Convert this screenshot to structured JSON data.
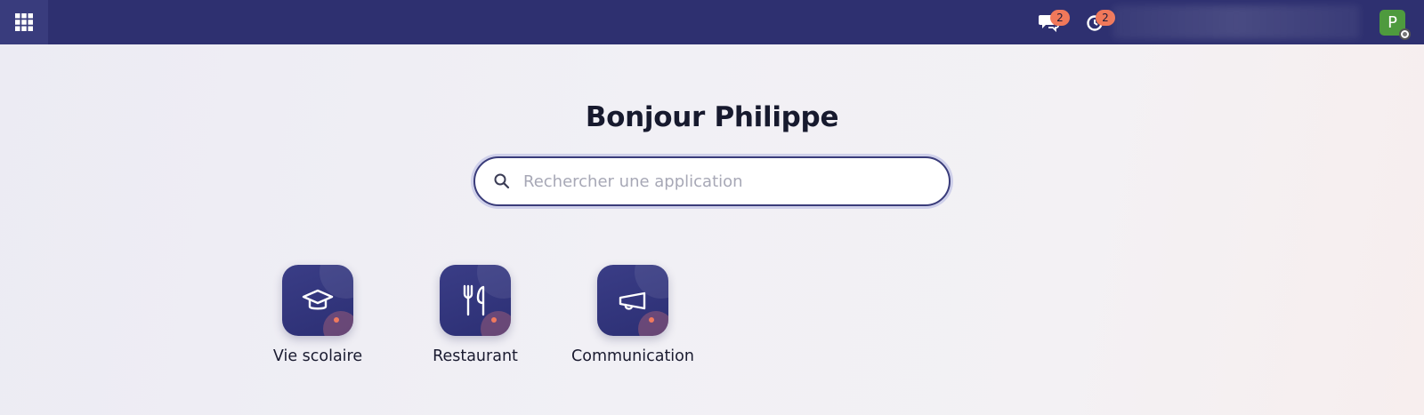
{
  "header": {
    "messages_badge": "2",
    "notifications_badge": "2",
    "avatar_initial": "P",
    "colors": {
      "bar": "#2e3070",
      "badge": "#f0785a",
      "avatar": "#4e9a3e"
    },
    "icons": [
      "app-grid-icon",
      "chat-bubbles-icon",
      "bell-icon",
      "status-icon"
    ]
  },
  "main": {
    "greeting": "Bonjour Philippe",
    "search": {
      "placeholder": "Rechercher une application",
      "value": ""
    }
  },
  "apps": [
    {
      "label": "Vie scolaire",
      "icon": "graduation-cap-icon"
    },
    {
      "label": "Restaurant",
      "icon": "fork-knife-icon"
    },
    {
      "label": "Communication",
      "icon": "megaphone-icon"
    }
  ]
}
